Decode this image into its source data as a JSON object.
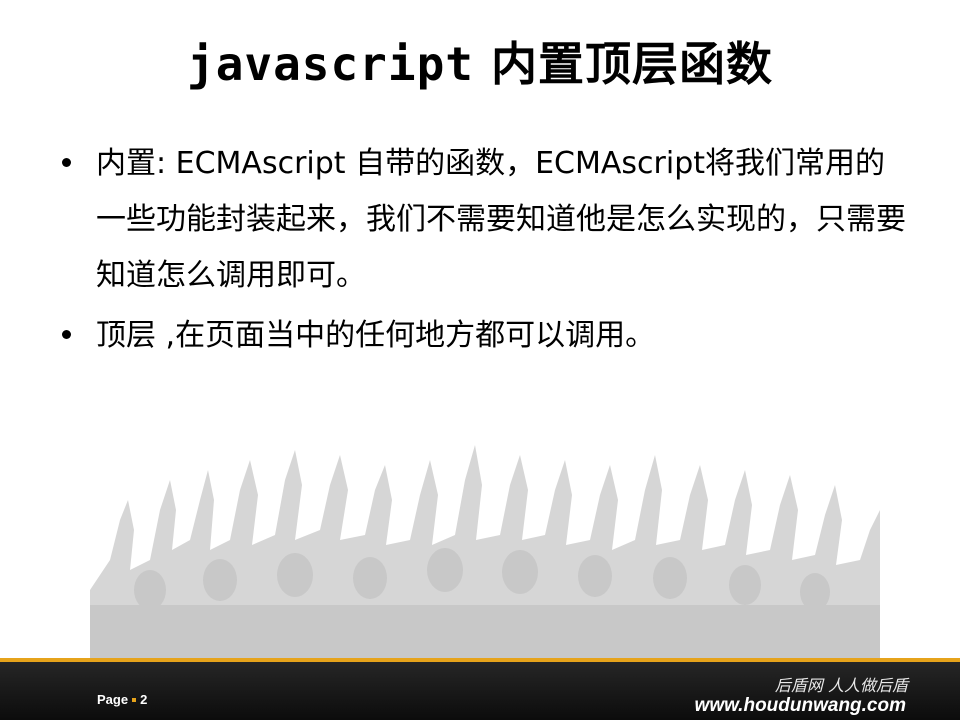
{
  "slide": {
    "title_code": "javascript",
    "title_rest": "内置顶层函数",
    "bullets": [
      "内置: ECMAscript 自带的函数，ECMAscript将我们常用的一些功能封装起来，我们不需要知道他是怎么实现的，只需要知道怎么调用即可。",
      "顶层 ,在页面当中的任何地方都可以调用。"
    ]
  },
  "footer": {
    "page_label": "Page",
    "page_number": "2",
    "brand_slogan": "后盾网 人人做后盾",
    "brand_url": "www.houdunwang.com"
  },
  "colors": {
    "accent": "#e6a31b",
    "footer_bg": "#1a1a1a",
    "crowd": "#d4d4d4"
  }
}
